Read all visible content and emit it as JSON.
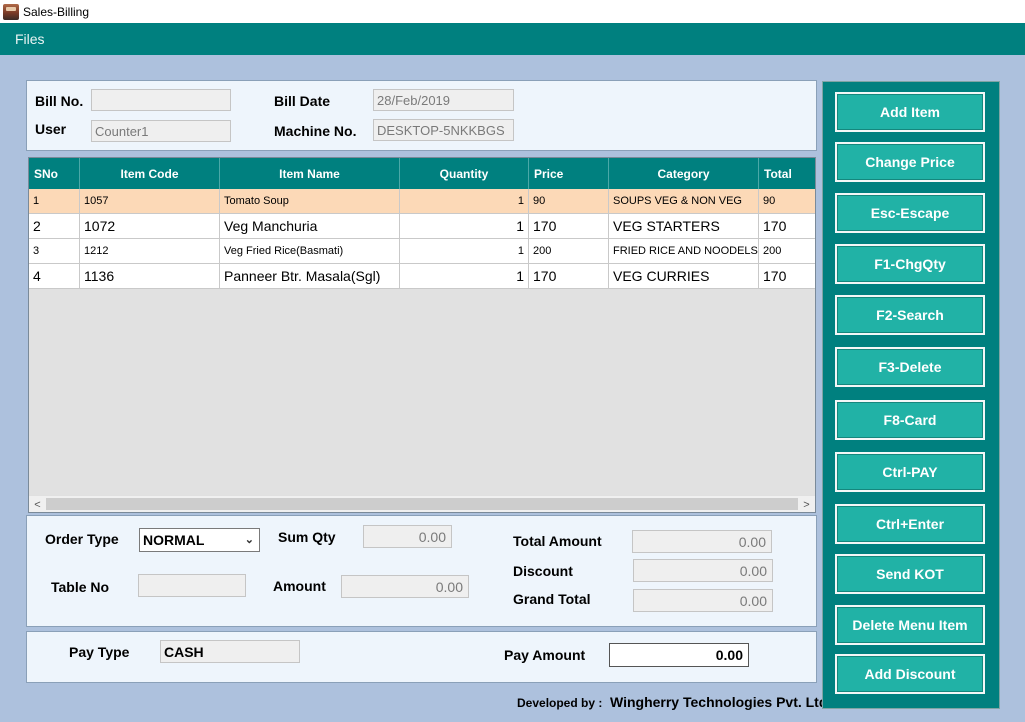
{
  "window": {
    "title": "Sales-Billing"
  },
  "menu": {
    "files": "Files"
  },
  "bill": {
    "bill_no_label": "Bill No.",
    "bill_no_value": "",
    "bill_date_label": "Bill Date",
    "bill_date_value": "28/Feb/2019",
    "user_label": "User",
    "user_value": "Counter1",
    "machine_label": "Machine No.",
    "machine_value": "DESKTOP-5NKKBGS"
  },
  "grid": {
    "headers": [
      "SNo",
      "Item Code",
      "Item Name",
      "Quantity",
      "Price",
      "Category",
      "Total"
    ],
    "rows": [
      {
        "sno": "1",
        "code": "1057",
        "name": "Tomato Soup",
        "qty": "1",
        "price": "90",
        "category": "SOUPS VEG & NON VEG",
        "total": "90"
      },
      {
        "sno": "2",
        "code": "1072",
        "name": "Veg Manchuria",
        "qty": "1",
        "price": "170",
        "category": "VEG STARTERS",
        "total": "170"
      },
      {
        "sno": "3",
        "code": "1212",
        "name": "Veg Fried Rice(Basmati)",
        "qty": "1",
        "price": "200",
        "category": "FRIED RICE AND NOODELS",
        "total": "200"
      },
      {
        "sno": "4",
        "code": "1136",
        "name": "Panneer Btr. Masala(Sgl)",
        "qty": "1",
        "price": "170",
        "category": "VEG CURRIES",
        "total": "170"
      }
    ],
    "scroll_left_icon": "<",
    "scroll_right_icon": ">"
  },
  "summary": {
    "order_type_label": "Order Type",
    "order_type_value": "NORMAL",
    "sum_qty_label": "Sum Qty",
    "sum_qty_value": "0.00",
    "table_no_label": "Table No",
    "table_no_value": "",
    "amount_label": "Amount",
    "amount_value": "0.00",
    "total_amount_label": "Total Amount",
    "total_amount_value": "0.00",
    "discount_label": "Discount",
    "discount_value": "0.00",
    "grand_total_label": "Grand Total",
    "grand_total_value": "0.00"
  },
  "payment": {
    "pay_type_label": "Pay Type",
    "pay_type_value": "CASH",
    "pay_amount_label": "Pay Amount",
    "pay_amount_value": "0.00"
  },
  "actions": [
    "Add Item",
    "Change Price",
    "Esc-Escape",
    "F1-ChgQty",
    "F2-Search",
    "F3-Delete",
    "F8-Card",
    "Ctrl-PAY",
    "Ctrl+Enter",
    "Send KOT",
    "Delete Menu Item",
    "Add Discount"
  ],
  "footer": {
    "developed_by": "Developed by :",
    "company": "Wingherry Technologies Pvt. Ltd."
  },
  "colors": {
    "teal": "#00807f",
    "button": "#21b2a6",
    "selected_row": "#fcd9b7",
    "background": "#adc1dd"
  }
}
